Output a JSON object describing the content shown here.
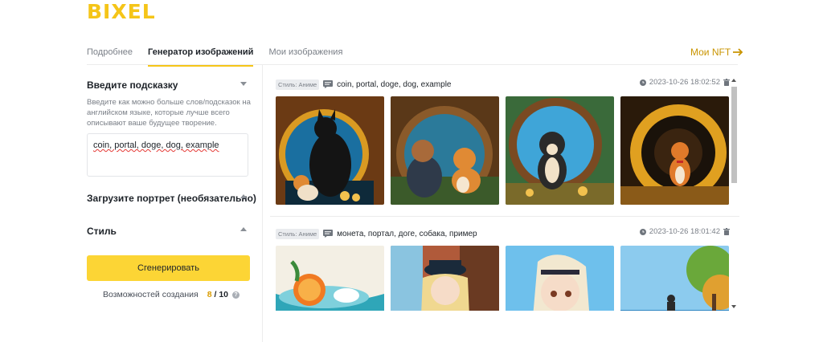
{
  "brand": {
    "logo": "BIXEL"
  },
  "tabs": [
    {
      "label": "Подробнее"
    },
    {
      "label": "Генератор изображений"
    },
    {
      "label": "Мои изображения"
    }
  ],
  "nft_link": {
    "label": "Мои NFT",
    "icon": "arrow-right-icon"
  },
  "left_panel": {
    "prompt_section": {
      "title": "Введите подсказку",
      "hint": "Введите как можно больше слов/подсказок на английском языке, которые лучше всего описывают ваше будущее творение.",
      "value": "coin, portal, doge, dog, example"
    },
    "portrait_section": {
      "title": "Загрузите портрет (необязательно)"
    },
    "style_section": {
      "title": "Стиль"
    },
    "generate_button": "Сгенерировать",
    "credits": {
      "label": "Возможностей создания",
      "used": "8",
      "separator": "/",
      "total": "10"
    }
  },
  "feed": [
    {
      "style_tag": "Стиль: Аниме",
      "prompt": "coin, portal, doge, dog, example",
      "date": "2023-10-26 18:02:52"
    },
    {
      "style_tag": "Стиль: Аниме",
      "prompt": "монета, портал, доге, собака, пример",
      "date": "2023-10-26 18:01:42"
    }
  ],
  "colors": {
    "accent": "#fcd535",
    "brand": "#f5c518",
    "link": "#c99400"
  }
}
